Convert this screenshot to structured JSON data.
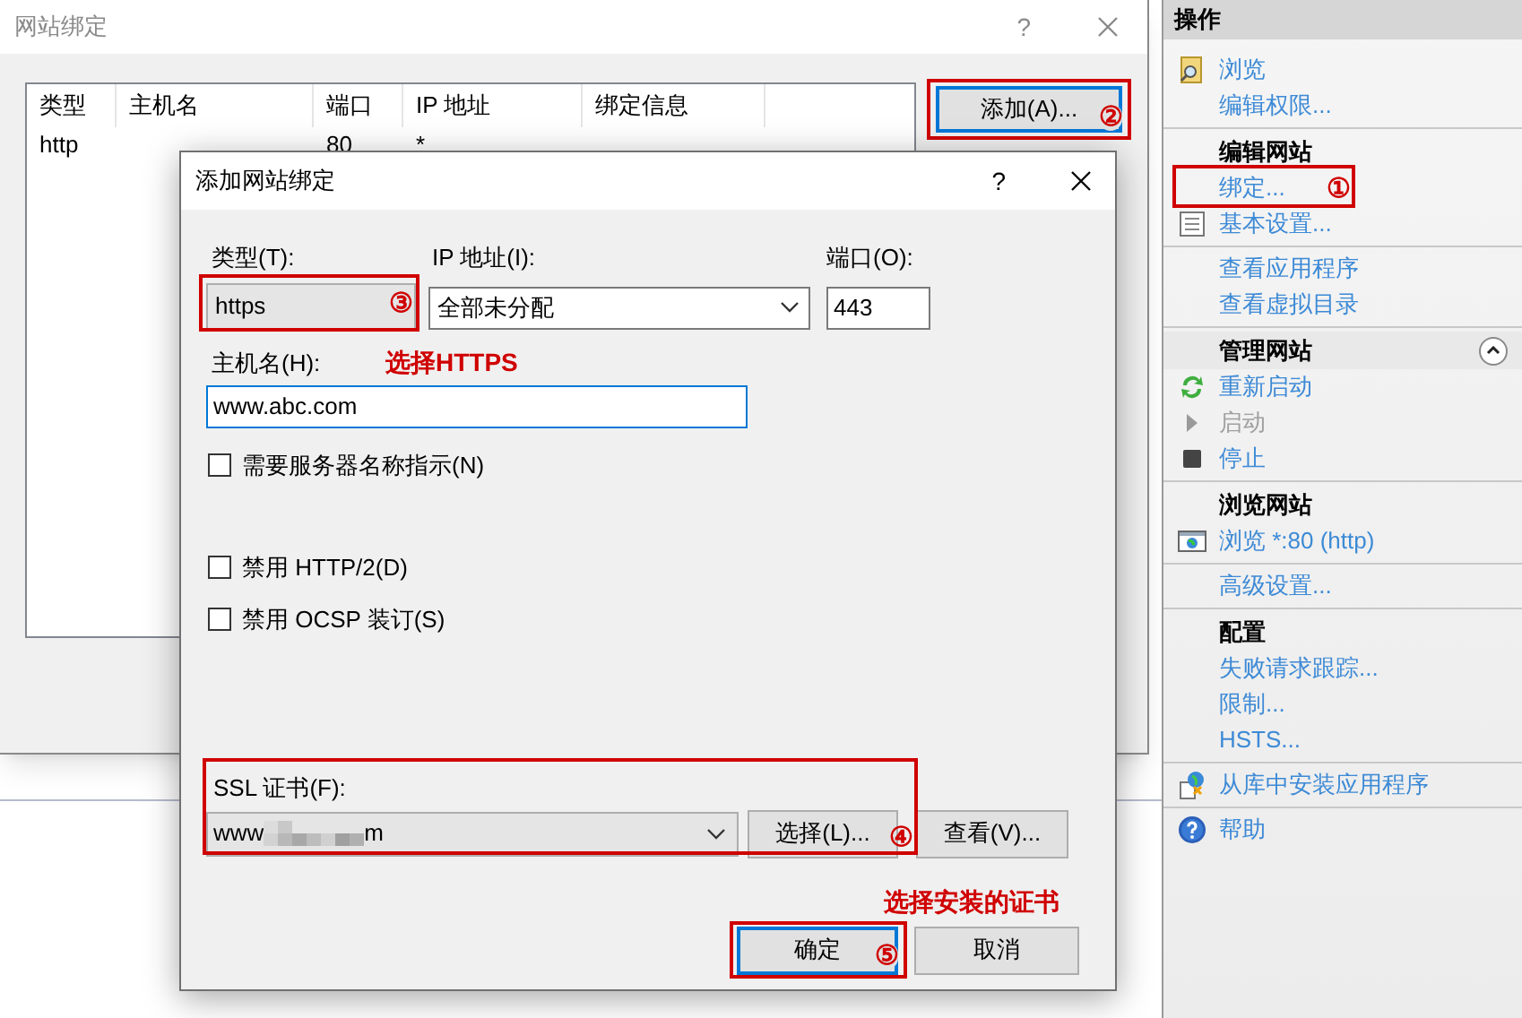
{
  "back_window": {
    "title": "网站绑定",
    "help": "?",
    "table": {
      "columns": [
        "类型",
        "主机名",
        "端口",
        "IP 地址",
        "绑定信息"
      ],
      "rows": [
        {
          "type": "http",
          "port": "80",
          "ip_address": "*"
        }
      ]
    },
    "add_button": {
      "label": "添加(A)...",
      "step": "②"
    }
  },
  "dialog": {
    "title": "添加网站绑定",
    "help": "?",
    "type": {
      "label": "类型(T):",
      "value": "https",
      "step": "③"
    },
    "ip_address": {
      "label": "IP 地址(I):",
      "value": "全部未分配"
    },
    "port": {
      "label": "端口(O):",
      "value": "443"
    },
    "host_name": {
      "label": "主机名(H):",
      "value": "www.abc.com",
      "note": "选择HTTPS"
    },
    "checkboxes": [
      {
        "label": "需要服务器名称指示(N)",
        "checked": false
      },
      {
        "label": "禁用 HTTP/2(D)",
        "checked": false
      },
      {
        "label": "禁用 OCSP 装订(S)",
        "checked": false
      }
    ],
    "ssl_certificate": {
      "label": "SSL 证书(F):",
      "value_start": "www",
      "value_end": "m",
      "select_button": "选择(L)...",
      "step": "④",
      "view_button": "查看(V)..."
    },
    "note": "选择安装的证书",
    "ok_button": {
      "label": "确定",
      "step": "⑤",
      "default": true
    },
    "cancel_button": "取消"
  },
  "actions_panel": {
    "title": "操作",
    "sections": [
      {
        "items": [
          {
            "label": "浏览",
            "disabled": false
          },
          {
            "label": "编辑权限...",
            "disabled": false
          }
        ]
      },
      {
        "heading": "编辑网站",
        "items": [
          {
            "label": "绑定...",
            "disabled": false,
            "step": "①"
          },
          {
            "label": "基本设置...",
            "disabled": false
          }
        ]
      },
      {
        "items": [
          {
            "label": "查看应用程序",
            "disabled": false
          },
          {
            "label": "查看虚拟目录",
            "disabled": false
          }
        ]
      },
      {
        "heading": "管理网站",
        "expanded": true,
        "items": [
          {
            "label": "重新启动",
            "disabled": false
          },
          {
            "label": "启动",
            "disabled": true
          },
          {
            "label": "停止",
            "disabled": false
          }
        ]
      },
      {
        "heading": "浏览网站",
        "items": [
          {
            "label": "浏览 *:80 (http)",
            "disabled": false
          }
        ]
      },
      {
        "items": [
          {
            "label": "高级设置...",
            "disabled": false
          }
        ]
      },
      {
        "heading": "配置",
        "items": [
          {
            "label": "失败请求跟踪...",
            "disabled": false
          },
          {
            "label": "限制...",
            "disabled": false
          },
          {
            "label": "HSTS...",
            "disabled": false
          }
        ]
      },
      {
        "items": [
          {
            "label": "从库中安装应用程序",
            "disabled": false
          }
        ]
      },
      {
        "items": [
          {
            "label": "帮助",
            "disabled": false
          }
        ]
      }
    ]
  }
}
